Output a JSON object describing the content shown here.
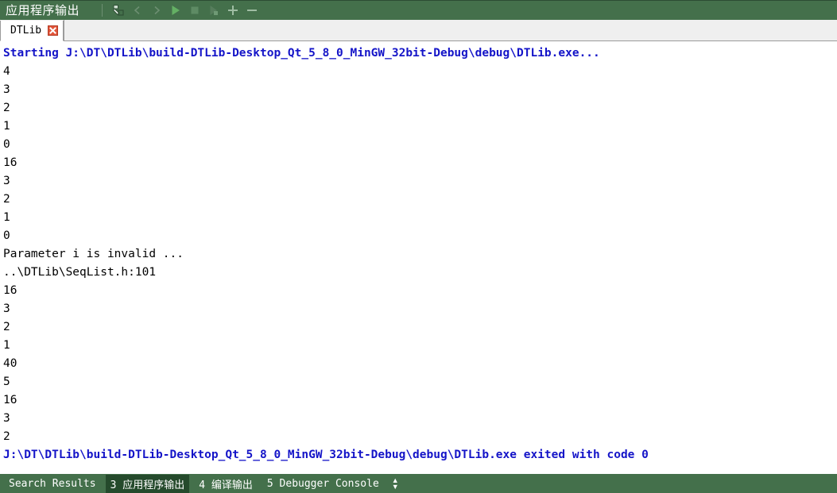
{
  "header": {
    "title": "应用程序输出",
    "toolbar": [
      {
        "name": "clear-pane-icon",
        "label": "Clear",
        "enabled": true
      },
      {
        "name": "chevron-left-icon",
        "label": "Previous Item",
        "enabled": false
      },
      {
        "name": "chevron-right-icon",
        "label": "Next Item",
        "enabled": false
      },
      {
        "name": "run-icon",
        "label": "Run",
        "enabled": true
      },
      {
        "name": "stop-icon",
        "label": "Stop",
        "enabled": true
      },
      {
        "name": "rerun-icon",
        "label": "Re-run",
        "enabled": false
      },
      {
        "name": "zoom-in-icon",
        "label": "Increase Font Size",
        "enabled": true
      },
      {
        "name": "zoom-out-icon",
        "label": "Decrease Font Size",
        "enabled": true
      }
    ]
  },
  "tabs": [
    {
      "label": "DTLib",
      "close_label": "x",
      "active": true
    }
  ],
  "console": {
    "lines": [
      {
        "text": "Starting J:\\DT\\DTLib\\build-DTLib-Desktop_Qt_5_8_0_MinGW_32bit-Debug\\debug\\DTLib.exe...",
        "style": "msg"
      },
      {
        "text": "4",
        "style": "out"
      },
      {
        "text": "3",
        "style": "out"
      },
      {
        "text": "2",
        "style": "out"
      },
      {
        "text": "1",
        "style": "out"
      },
      {
        "text": "0",
        "style": "out"
      },
      {
        "text": "16",
        "style": "out"
      },
      {
        "text": "3",
        "style": "out"
      },
      {
        "text": "2",
        "style": "out"
      },
      {
        "text": "1",
        "style": "out"
      },
      {
        "text": "0",
        "style": "out"
      },
      {
        "text": "Parameter i is invalid ...",
        "style": "out"
      },
      {
        "text": "..\\DTLib\\SeqList.h:101",
        "style": "out"
      },
      {
        "text": "16",
        "style": "out"
      },
      {
        "text": "3",
        "style": "out"
      },
      {
        "text": "2",
        "style": "out"
      },
      {
        "text": "1",
        "style": "out"
      },
      {
        "text": "40",
        "style": "out"
      },
      {
        "text": "5",
        "style": "out"
      },
      {
        "text": "16",
        "style": "out"
      },
      {
        "text": "3",
        "style": "out"
      },
      {
        "text": "2",
        "style": "out"
      },
      {
        "text": "J:\\DT\\DTLib\\build-DTLib-Desktop_Qt_5_8_0_MinGW_32bit-Debug\\debug\\DTLib.exe exited with code 0",
        "style": "msg"
      }
    ]
  },
  "statusbar": {
    "items": [
      {
        "label": "Search Results",
        "active": false
      },
      {
        "label": "3 应用程序输出",
        "active": true
      },
      {
        "label": "4 编译输出",
        "active": false
      },
      {
        "label": "5 Debugger Console",
        "active": false
      }
    ],
    "arrows": {
      "up": "▲",
      "down": "▼"
    }
  },
  "colors": {
    "header_green": "#44704b",
    "status_active": "#254a2c",
    "message_blue": "#1414c8",
    "tab_close_red": "#e2553a",
    "tabstrip_bg": "#efefef"
  }
}
